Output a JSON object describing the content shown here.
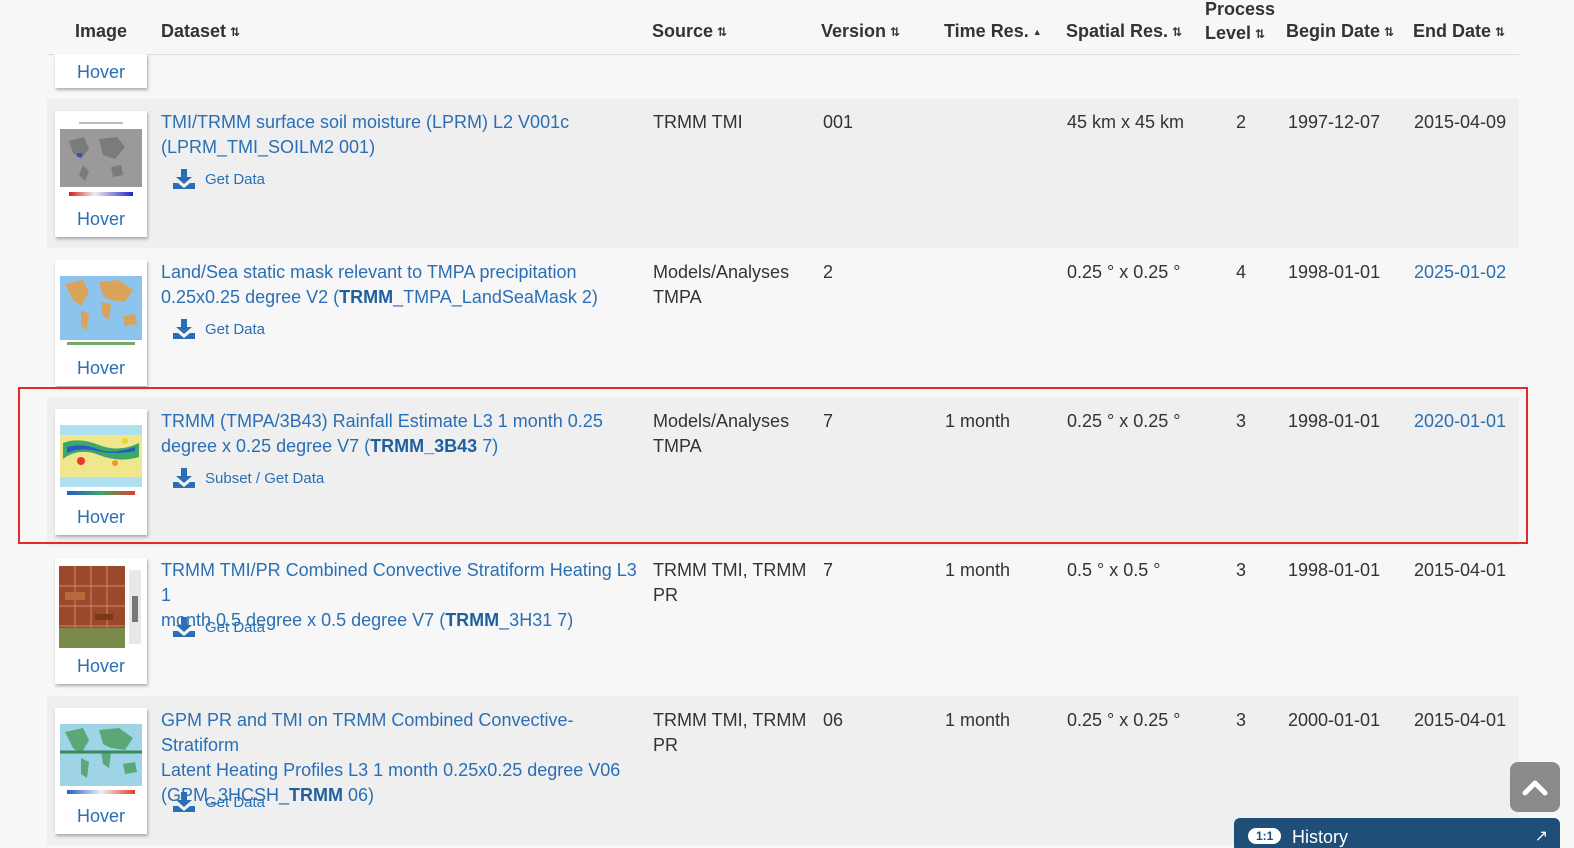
{
  "columns": {
    "image": "Image",
    "dataset": "Dataset",
    "source": "Source",
    "version": "Version",
    "time_res": "Time Res.",
    "spatial_res": "Spatial Res.",
    "process_level_top": "Process",
    "process_level_bottom": "Level",
    "begin_date": "Begin Date",
    "end_date": "End Date"
  },
  "sort_icons": {
    "unsorted": "⇅",
    "ascending": "▲"
  },
  "hover_label": "Hover",
  "rows": [
    {
      "title_lines": [
        "TMI/TRMM surface soil moisture (LPRM) L2 V001c",
        "(LPRM_TMI_SOILM2 001)"
      ],
      "action": "Get Data",
      "source_lines": [
        "TRMM TMI"
      ],
      "version": "001",
      "time_res": "",
      "spatial_res": "45 km x 45 km",
      "process_level": "2",
      "begin_date": "1997-12-07",
      "end_date": "2015-04-09"
    },
    {
      "title_pre": "Land/Sea static mask relevant to TMPA precipitation",
      "title_line2_pre": "0.25x0.25 degree V2 (",
      "title_bold": "TRMM",
      "title_post": "_TMPA_LandSeaMask 2)",
      "action": "Get Data",
      "source_lines": [
        "Models/Analyses",
        "TMPA"
      ],
      "version": "2",
      "time_res": "",
      "spatial_res": "0.25 ° x 0.25 °",
      "process_level": "4",
      "begin_date": "1998-01-01",
      "end_date": "2025-01-02"
    },
    {
      "title_pre": "TRMM (TMPA/3B43) Rainfall Estimate L3 1 month 0.25",
      "title_line2_pre": "degree x 0.25 degree V7 (",
      "title_bold": "TRMM_3B43",
      "title_post": " 7)",
      "action": "Subset / Get Data",
      "source_lines": [
        "Models/Analyses",
        "TMPA"
      ],
      "version": "7",
      "time_res": "1 month",
      "spatial_res": "0.25 ° x 0.25 °",
      "process_level": "3",
      "begin_date": "1998-01-01",
      "end_date": "2020-01-01"
    },
    {
      "title_pre": "TRMM TMI/PR Combined Convective Stratiform Heating L3 1",
      "title_line2_pre": "month 0.5 degree x 0.5 degree V7 (",
      "title_bold": "TRMM",
      "title_post": "_3H31 7)",
      "action": "Get Data",
      "source_lines": [
        "TRMM TMI, TRMM",
        "PR"
      ],
      "version": "7",
      "time_res": "1 month",
      "spatial_res": "0.5 ° x 0.5 °",
      "process_level": "3",
      "begin_date": "1998-01-01",
      "end_date": "2015-04-01"
    },
    {
      "title_pre": "GPM PR and TMI on TRMM Combined Convective-Stratiform",
      "title_line2_pre": "Latent Heating Profiles L3 1 month 0.25x0.25 degree V06",
      "title_line3_pre": "(GPM_3HCSH_",
      "title_bold": "TRMM",
      "title_post": " 06)",
      "action": "Get Data",
      "source_lines": [
        "TRMM TMI, TRMM",
        "PR"
      ],
      "version": "06",
      "time_res": "1 month",
      "spatial_res": "0.25 ° x 0.25 °",
      "process_level": "3",
      "begin_date": "2000-01-01",
      "end_date": "2015-04-01"
    }
  ],
  "history_panel": {
    "badge": "1:1",
    "title": "History"
  },
  "colors": {
    "link": "#2a6fb5",
    "highlight_border": "#e02b2b",
    "history_bg": "#1f4e79"
  }
}
